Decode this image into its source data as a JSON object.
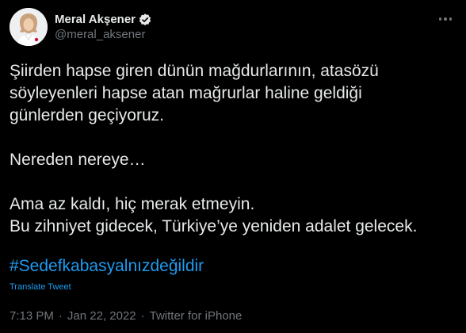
{
  "author": {
    "name": "Meral Akşener",
    "handle": "@meral_aksener"
  },
  "tweet": {
    "paragraph1": "Şiirden hapse giren dünün mağdurlarının, atasözü\nsöyleyenleri hapse atan mağrurlar haline geldiği\ngünlerden geçiyoruz.",
    "paragraph2": "Nereden nereye…",
    "paragraph3": "Ama az kaldı, hiç merak etmeyin.\nBu zihniyet gidecek, Türkiye’ye yeniden adalet gelecek.",
    "hashtag": "#Sedefkabasyalnızdeğildir",
    "translate_label": "Translate Tweet"
  },
  "meta": {
    "time": "7:13 PM",
    "separator": "·",
    "date": "Jan 22, 2022",
    "source": "Twitter for iPhone"
  },
  "icons": {
    "verified": "verified-badge-icon",
    "more": "more-options-icon"
  },
  "colors": {
    "background": "#000000",
    "text": "#e7e9ea",
    "secondary": "#71767b",
    "accent": "#1d9bf0"
  }
}
